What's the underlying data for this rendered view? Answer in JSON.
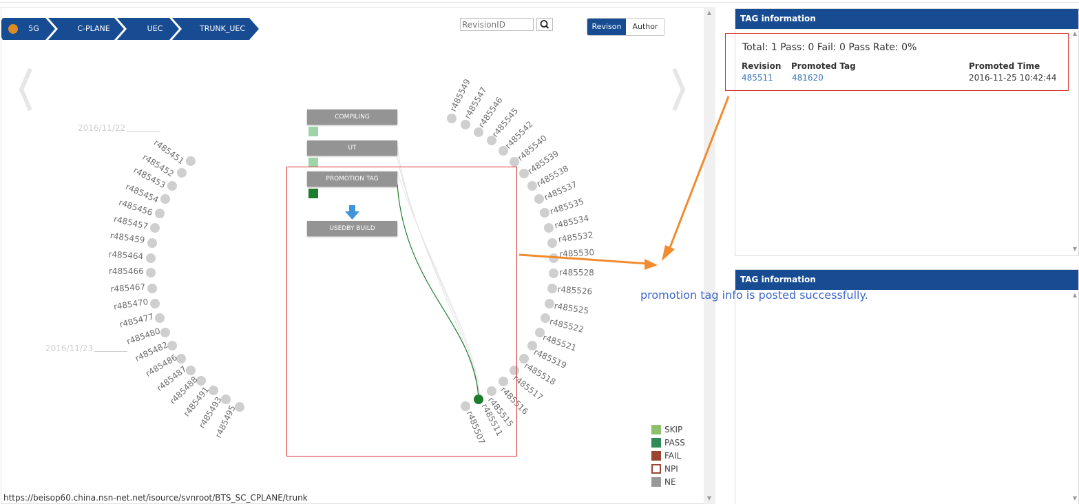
{
  "breadcrumb": {
    "items": [
      "5G",
      "C-PLANE",
      "UEC",
      "TRUNK_UEC"
    ]
  },
  "search": {
    "placeholder": "RevisionID"
  },
  "toggle": {
    "options": [
      "Revison",
      "Author"
    ],
    "selected": "Revison"
  },
  "timeline": {
    "dates": [
      "2016/11/22",
      "2016/11/23"
    ],
    "left_revisions": [
      "r485451",
      "r485452",
      "r485453",
      "r485454",
      "r485456",
      "r485457",
      "r485459",
      "r485464",
      "r485466",
      "r485467",
      "r485470",
      "r485477",
      "r485480",
      "r485482",
      "r485486",
      "r485487",
      "r485488",
      "r485491",
      "r485493",
      "r485495"
    ],
    "right_revisions": [
      "r485549",
      "r485547",
      "r485546",
      "r485545",
      "r485542",
      "r485540",
      "r485539",
      "r485538",
      "r485537",
      "r485535",
      "r485534",
      "r485532",
      "r485530",
      "r485528",
      "r485526",
      "r485525",
      "r485522",
      "r485521",
      "r485519",
      "r485518",
      "r485517",
      "r485516",
      "r485515",
      "r485511",
      "r485507"
    ],
    "highlighted_revision": "r485511"
  },
  "stages": [
    {
      "label": "COMPILING",
      "status": "SKIP"
    },
    {
      "label": "UT",
      "status": "SKIP"
    },
    {
      "label": "PROMOTION TAG",
      "status": "PASS"
    },
    {
      "label": "USEDBY BUILD",
      "status": null
    }
  ],
  "legend": [
    {
      "label": "SKIP",
      "color": "#8dc06b"
    },
    {
      "label": "PASS",
      "color": "#2e8a57"
    },
    {
      "label": "FAIL",
      "color": "#9a4534"
    },
    {
      "label": "NPI",
      "color": "#ffffff",
      "border": "#9a4534"
    },
    {
      "label": "NE",
      "color": "#999999"
    }
  ],
  "status_url": "https://beisop60.china.nsn-net.net/isource/svnroot/BTS_SC_CPLANE/trunk",
  "tag_panel_top": {
    "title": "TAG information",
    "summary": "Total: 1 Pass: 0 Fail: 0 Pass Rate: 0%",
    "columns": [
      "Revision",
      "Promoted Tag",
      "Promoted Time"
    ],
    "row": {
      "revision": "485511",
      "tag": "481620",
      "time": "2016-11-25 10:42:44"
    }
  },
  "tag_panel_bottom": {
    "title": "TAG information"
  },
  "annotation": "promotion tag info is posted successfully.",
  "colors": {
    "brand": "#174c93",
    "accent_orange": "#f28a2e",
    "highlight_red": "#d92f2f",
    "pass_green": "#1e7d2c"
  }
}
